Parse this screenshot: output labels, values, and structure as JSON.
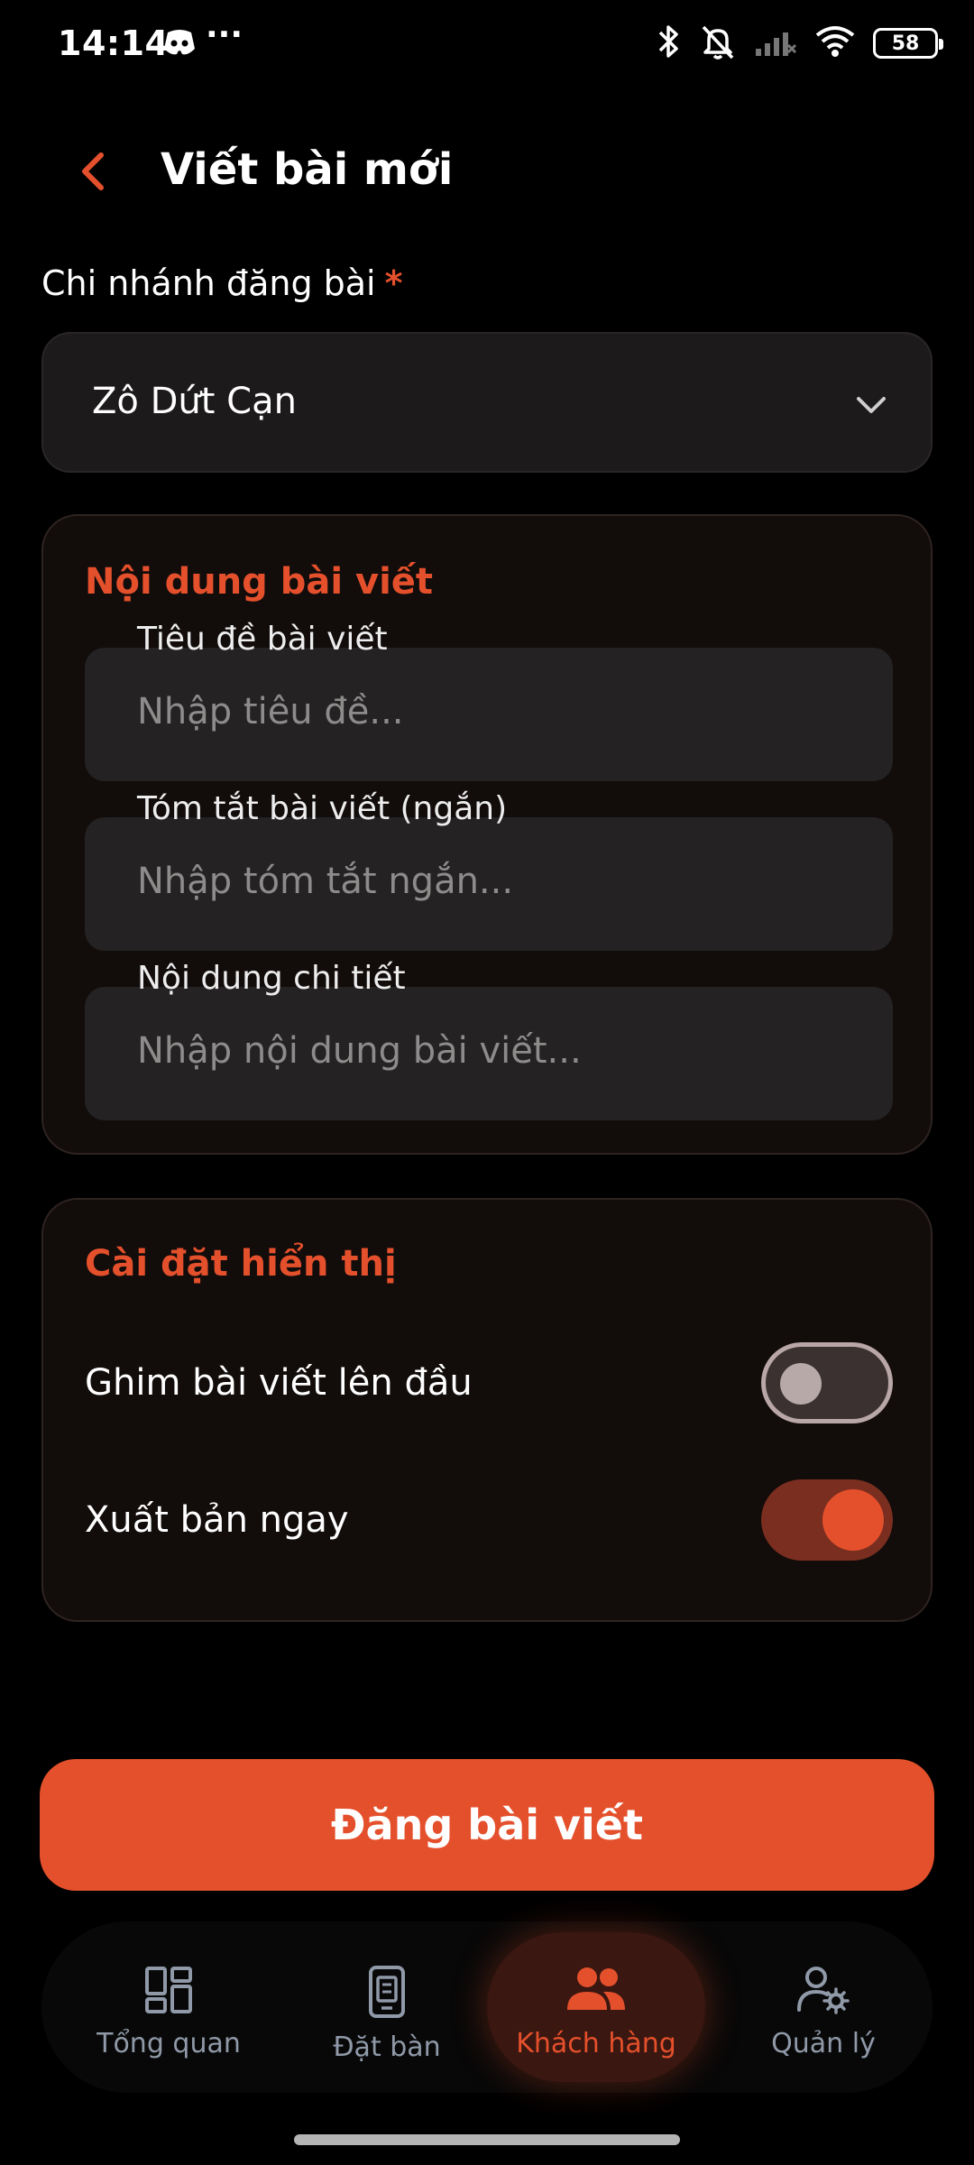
{
  "status_bar": {
    "time": "14:14",
    "more": "···",
    "battery": "58",
    "icons": [
      "discord-icon",
      "bluetooth-icon",
      "mute-icon",
      "signal-icon",
      "wifi-icon",
      "battery-icon"
    ]
  },
  "header": {
    "title": "Viết bài mới"
  },
  "branch": {
    "label": "Chi nhánh đăng bài",
    "required": "*",
    "value": "Zô Dứt Cạn"
  },
  "content_card": {
    "heading": "Nội dung bài viết",
    "fields": [
      {
        "label": "Tiêu đề bài viết",
        "placeholder": "Nhập tiêu đề..."
      },
      {
        "label": "Tóm tắt bài viết (ngắn)",
        "placeholder": "Nhập tóm tắt ngắn..."
      },
      {
        "label": "Nội dung chi tiết",
        "placeholder": "Nhập nội dung bài viết..."
      }
    ]
  },
  "display_card": {
    "heading": "Cài đặt hiển thị",
    "settings": [
      {
        "label": "Ghim bài viết lên đầu",
        "enabled": false
      },
      {
        "label": "Xuất bản ngay",
        "enabled": true
      }
    ]
  },
  "submit_label": "Đăng bài viết",
  "nav": {
    "items": [
      {
        "label": "Tổng quan",
        "icon": "dashboard-icon"
      },
      {
        "label": "Đặt bàn",
        "icon": "booking-icon"
      },
      {
        "label": "Khách hàng",
        "icon": "customers-icon",
        "active": true
      },
      {
        "label": "Quản lý",
        "icon": "user-settings-icon"
      }
    ]
  },
  "colors": {
    "accent": "#e4502c",
    "background": "#000000",
    "card": "#120c0b",
    "input": "#242223",
    "nav_inactive": "#8f99a8"
  }
}
